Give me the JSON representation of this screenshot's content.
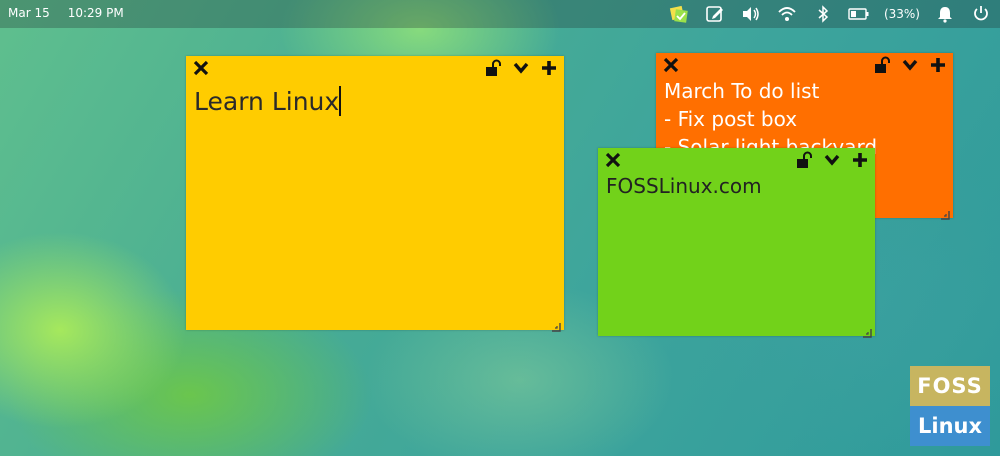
{
  "topbar": {
    "date": "Mar 15",
    "time": "10:29 PM",
    "battery_percent": "(33%)",
    "icons": [
      "indicator-stickynotes-icon",
      "notes-edit-icon",
      "volume-icon",
      "wifi-icon",
      "bluetooth-icon",
      "battery-icon",
      "notification-bell-icon",
      "power-icon"
    ]
  },
  "notes": {
    "yellow": {
      "text": "Learn Linux",
      "color": "#ffcc00"
    },
    "orange": {
      "text": "March To do list\n- Fix post box\n- Solar light backyard",
      "color": "#ff6f00"
    },
    "green": {
      "text": "FOSSLinux.com",
      "color": "#72d21a"
    }
  },
  "watermark": {
    "top": "FOSS",
    "bottom": "Linux",
    "top_color": "#c7b560",
    "bottom_color": "#3e8fcf"
  }
}
